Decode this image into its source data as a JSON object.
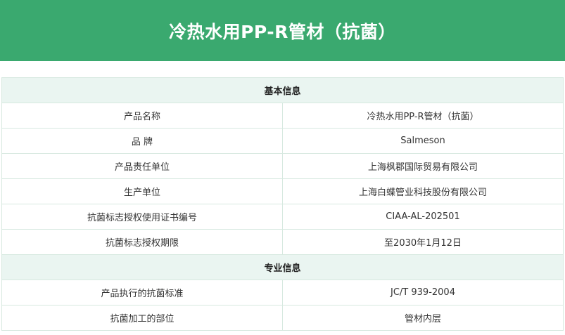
{
  "title": "冷热水用PP-R管材（抗菌）",
  "colors": {
    "header_bg": "#3aa96f",
    "section_bg": "#eaf5f1",
    "border": "#d7e9e0"
  },
  "sections": [
    {
      "heading": "基本信息",
      "rows": [
        {
          "label": "产品名称",
          "value": "冷热水用PP-R管材（抗菌）"
        },
        {
          "label": "品 牌",
          "value": "Salmeson"
        },
        {
          "label": "产品责任单位",
          "value": "上海枫郡国际贸易有限公司"
        },
        {
          "label": "生产单位",
          "value": "上海白蝶管业科技股份有限公司"
        },
        {
          "label": "抗菌标志授权使用证书编号",
          "value": "CIAA-AL-202501"
        },
        {
          "label": "抗菌标志授权期限",
          "value": "至2030年1月12日"
        }
      ]
    },
    {
      "heading": "专业信息",
      "rows": [
        {
          "label": "产品执行的抗菌标准",
          "value": "JC/T 939-2004"
        },
        {
          "label": "抗菌加工的部位",
          "value": "管材内层"
        }
      ]
    }
  ]
}
